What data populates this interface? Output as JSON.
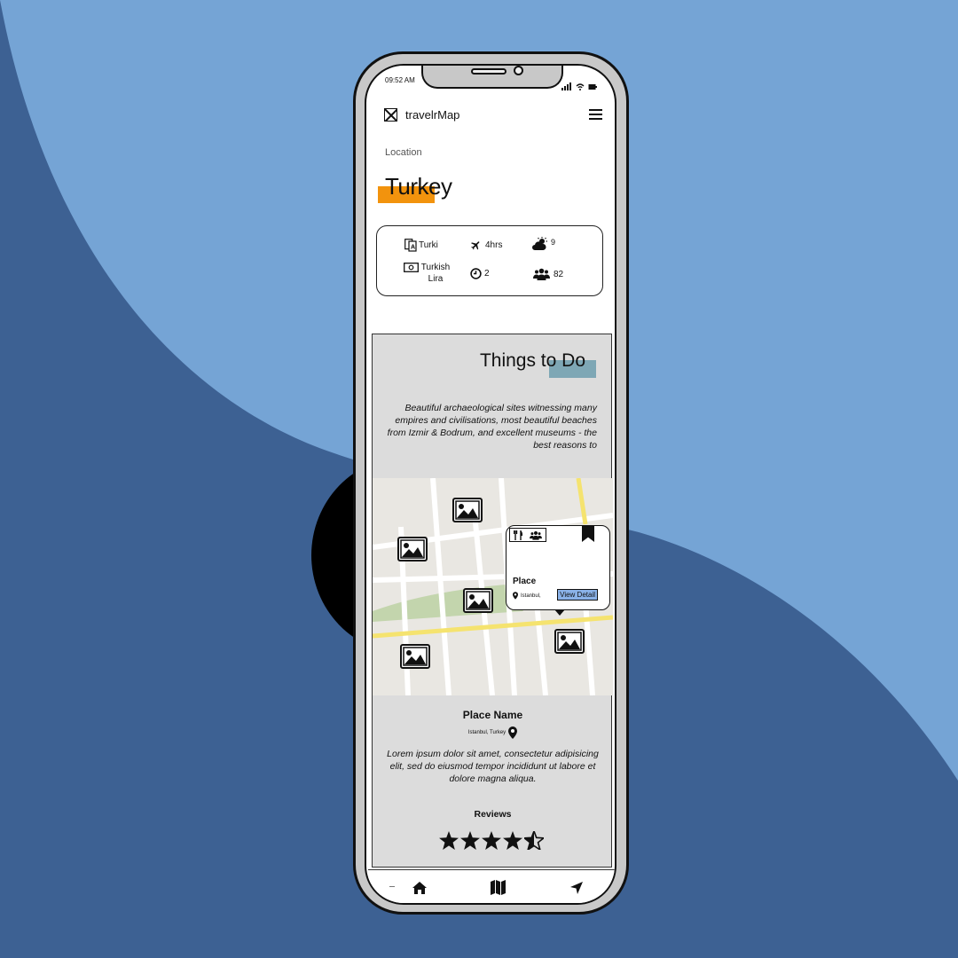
{
  "status_bar": {
    "time": "09:52 AM"
  },
  "app": {
    "name": "travelrMap"
  },
  "location": {
    "label": "Location",
    "country": "Turkey"
  },
  "country_info": {
    "language": "Turki",
    "flight_time": "4hrs",
    "weather": "9",
    "currency": "Turkish Lira",
    "timezone": "2",
    "population": "82"
  },
  "things_to_do": {
    "title": "Things to Do",
    "description": "Beautiful archaeological sites witnessing many empires and civilisations, most beautiful beaches from Izmir & Bodrum, and excellent museums - the best reasons to"
  },
  "map_popup": {
    "place": "Place",
    "location": "Istanbul,",
    "button": "View Detail"
  },
  "place": {
    "name": "Place Name",
    "location": "Istanbul, Turkey",
    "description": "Lorem ipsum dolor sit amet, consectetur adipisicing elit, sed do eiusmod tempor incididunt ut labore et dolore magna aliqua.",
    "reviews_label": "Reviews",
    "rating": 4.5,
    "rating_max": 5
  },
  "bottom_nav": [
    "home-icon",
    "map-icon",
    "navigate-icon"
  ],
  "colors": {
    "bg_dark": "#3d6193",
    "bg_light": "#75a4d5",
    "country_highlight": "#f2930d",
    "things_highlight": "#7ea7b5"
  }
}
